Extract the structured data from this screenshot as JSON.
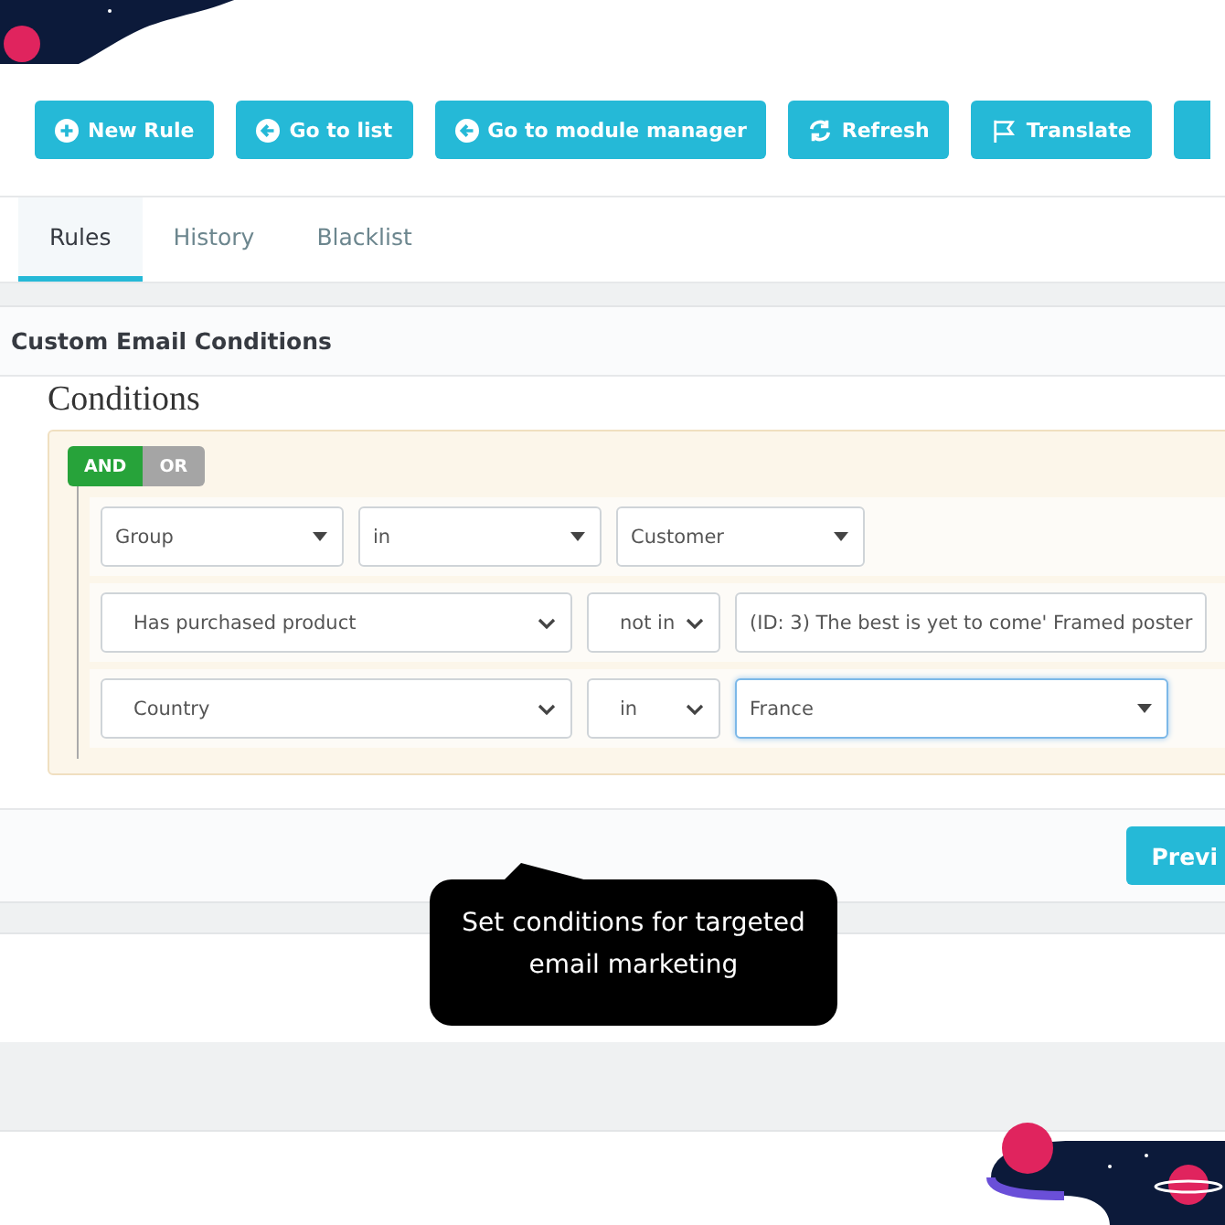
{
  "toolbar": {
    "buttons": [
      {
        "label": "New Rule",
        "kind": "plus"
      },
      {
        "label": "Go to list",
        "kind": "back"
      },
      {
        "label": "Go to module manager",
        "kind": "back"
      },
      {
        "label": "Refresh",
        "kind": "refresh"
      },
      {
        "label": "Translate",
        "kind": "flag"
      }
    ]
  },
  "tabs": [
    {
      "label": "Rules",
      "selected": true
    },
    {
      "label": "History",
      "selected": false
    },
    {
      "label": "Blacklist",
      "selected": false
    }
  ],
  "panel": {
    "title": "Custom Email Conditions",
    "heading": "Conditions",
    "logic": [
      {
        "label": "AND",
        "selected": true
      },
      {
        "label": "OR",
        "selected": false
      }
    ],
    "rules": [
      {
        "kind": "caret",
        "field": "Group",
        "operator": "in",
        "value": "Customer",
        "focused": false
      },
      {
        "kind": "chevron",
        "field": "Has purchased product",
        "operator": "not in",
        "value": "(ID: 3) The best is yet to come' Framed poster",
        "focused": false
      },
      {
        "kind": "chevron",
        "field": "Country",
        "operator": "in",
        "value": "France",
        "focused": true
      }
    ]
  },
  "footer": {
    "button": "Previ"
  },
  "tooltip": {
    "text": "Set conditions for targeted email marketing"
  }
}
